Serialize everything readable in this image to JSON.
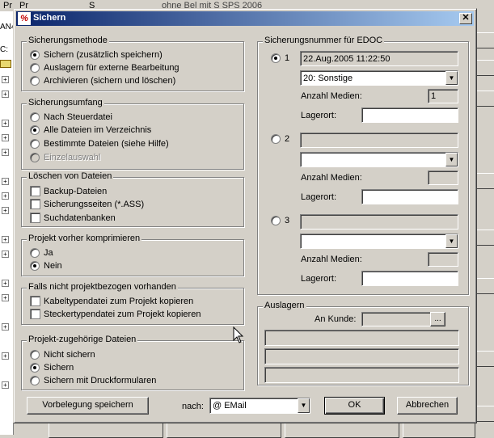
{
  "background": {
    "menu": [
      "Pr",
      "Pr",
      "S",
      "ohne Bel  mit S  SPS 2006"
    ],
    "left_text": [
      "C:",
      "AN4"
    ]
  },
  "dialog": {
    "title": "Sichern",
    "app_icon_text": "%",
    "close_glyph": "✕",
    "sicherungsmethode": {
      "title": "Sicherungsmethode",
      "options": [
        "Sichern (zusätzlich speichern)",
        "Auslagern für externe Bearbeitung",
        "Archivieren (sichern und löschen)"
      ],
      "selected": 0
    },
    "sicherungsumfang": {
      "title": "Sicherungsumfang",
      "options": [
        "Nach Steuerdatei",
        "Alle Dateien im Verzeichnis",
        "Bestimmte Dateien (siehe Hilfe)",
        "Einzelauswahl"
      ],
      "selected": 1
    },
    "loeschen": {
      "title": "Löschen von Dateien",
      "options": [
        "Backup-Dateien",
        "Sicherungsseiten (*.ASS)",
        "Suchdatenbanken"
      ]
    },
    "komprimieren": {
      "title": "Projekt vorher komprimieren",
      "options": [
        "Ja",
        "Nein"
      ],
      "selected": 1
    },
    "projektbezogen": {
      "title": "Falls nicht projektbezogen vorhanden",
      "options": [
        "Kabeltypendatei zum Projekt kopieren",
        "Steckertypendatei zum Projekt kopieren"
      ]
    },
    "zugehoerige": {
      "title": "Projekt-zugehörige Dateien",
      "options": [
        "Nicht sichern",
        "Sichern",
        "Sichern mit Druckformularen"
      ],
      "selected": 1
    },
    "edoc": {
      "title": "Sicherungsnummer für EDOC",
      "selected": 0,
      "slots": [
        {
          "number": "1",
          "date": "22.Aug.2005 11:22:50",
          "combo": "20: Sonstige",
          "anzahl_label": "Anzahl Medien:",
          "anzahl": "1",
          "lagerort_label": "Lagerort:",
          "lagerort": ""
        },
        {
          "number": "2",
          "date": "",
          "combo": "",
          "anzahl_label": "Anzahl Medien:",
          "anzahl": "",
          "lagerort_label": "Lagerort:",
          "lagerort": ""
        },
        {
          "number": "3",
          "date": "",
          "combo": "",
          "anzahl_label": "Anzahl Medien:",
          "anzahl": "",
          "lagerort_label": "Lagerort:",
          "lagerort": ""
        }
      ]
    },
    "auslagern": {
      "title": "Auslagern",
      "an_kunde_label": "An Kunde:",
      "an_kunde_value": "",
      "browse_label": "...",
      "lines": [
        "",
        "",
        ""
      ]
    },
    "footer": {
      "vorbelegung_label": "Vorbelegung speichern",
      "nach_label": "nach:",
      "nach_value": "@ EMail",
      "ok_label": "OK",
      "abbrechen_label": "Abbrechen"
    }
  }
}
